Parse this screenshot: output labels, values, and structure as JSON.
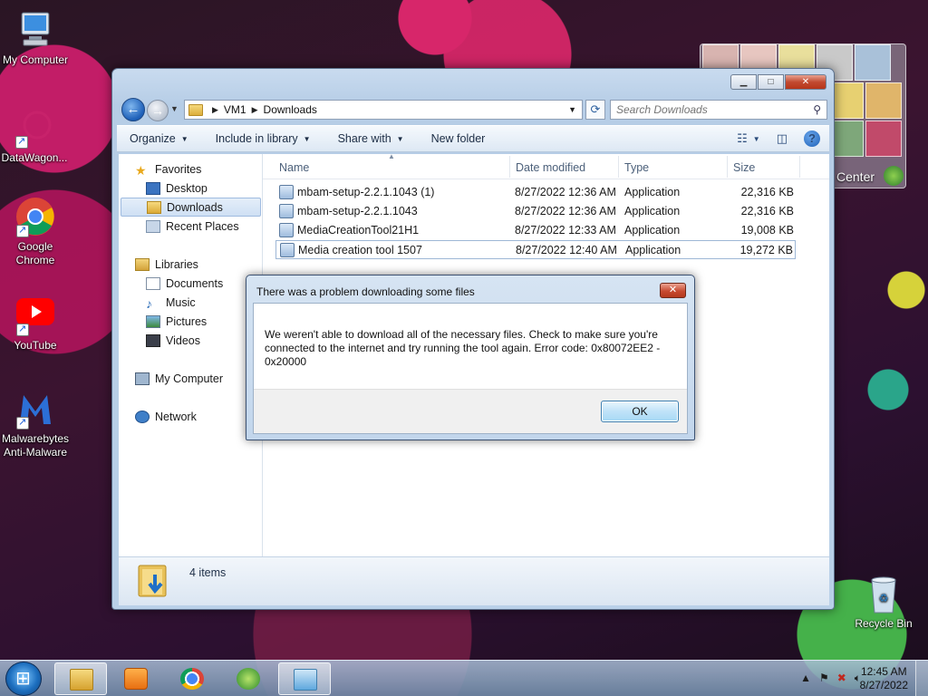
{
  "desktop": {
    "icons": [
      {
        "label": "My Computer"
      },
      {
        "label": "DataWagon..."
      },
      {
        "label": "Google Chrome"
      },
      {
        "label": "YouTube"
      },
      {
        "label": "Malwarebytes Anti-Malware"
      },
      {
        "label": "Recycle Bin"
      }
    ],
    "gadget_text": "Center"
  },
  "explorer": {
    "breadcrumb": [
      "VM1",
      "Downloads"
    ],
    "search_placeholder": "Search Downloads",
    "toolbar": {
      "organize": "Organize",
      "include_in_library": "Include in library",
      "share_with": "Share with",
      "new_folder": "New folder",
      "help": "?"
    },
    "nav": {
      "favorites": "Favorites",
      "desktop": "Desktop",
      "downloads": "Downloads",
      "recent_places": "Recent Places",
      "libraries": "Libraries",
      "documents": "Documents",
      "music": "Music",
      "pictures": "Pictures",
      "videos": "Videos",
      "my_computer": "My Computer",
      "network": "Network"
    },
    "columns": {
      "name": "Name",
      "date": "Date modified",
      "type": "Type",
      "size": "Size"
    },
    "files": [
      {
        "name": "mbam-setup-2.2.1.1043 (1)",
        "date": "8/27/2022 12:36 AM",
        "type": "Application",
        "size": "22,316 KB"
      },
      {
        "name": "mbam-setup-2.2.1.1043",
        "date": "8/27/2022 12:36 AM",
        "type": "Application",
        "size": "22,316 KB"
      },
      {
        "name": "MediaCreationTool21H1",
        "date": "8/27/2022 12:33 AM",
        "type": "Application",
        "size": "19,008 KB"
      },
      {
        "name": "Media creation tool 1507",
        "date": "8/27/2022 12:40 AM",
        "type": "Application",
        "size": "19,272 KB"
      }
    ],
    "item_count": "4 items"
  },
  "dialog": {
    "title": "There was a problem downloading some files",
    "message": "We weren't able to download all of the necessary files. Check to make sure you're connected to the internet and try running the tool again. Error code: 0x80072EE2 - 0x20000",
    "ok_label": "OK",
    "close_glyph": "✕"
  },
  "taskbar": {
    "time": "12:45 AM",
    "date": "8/27/2022"
  }
}
